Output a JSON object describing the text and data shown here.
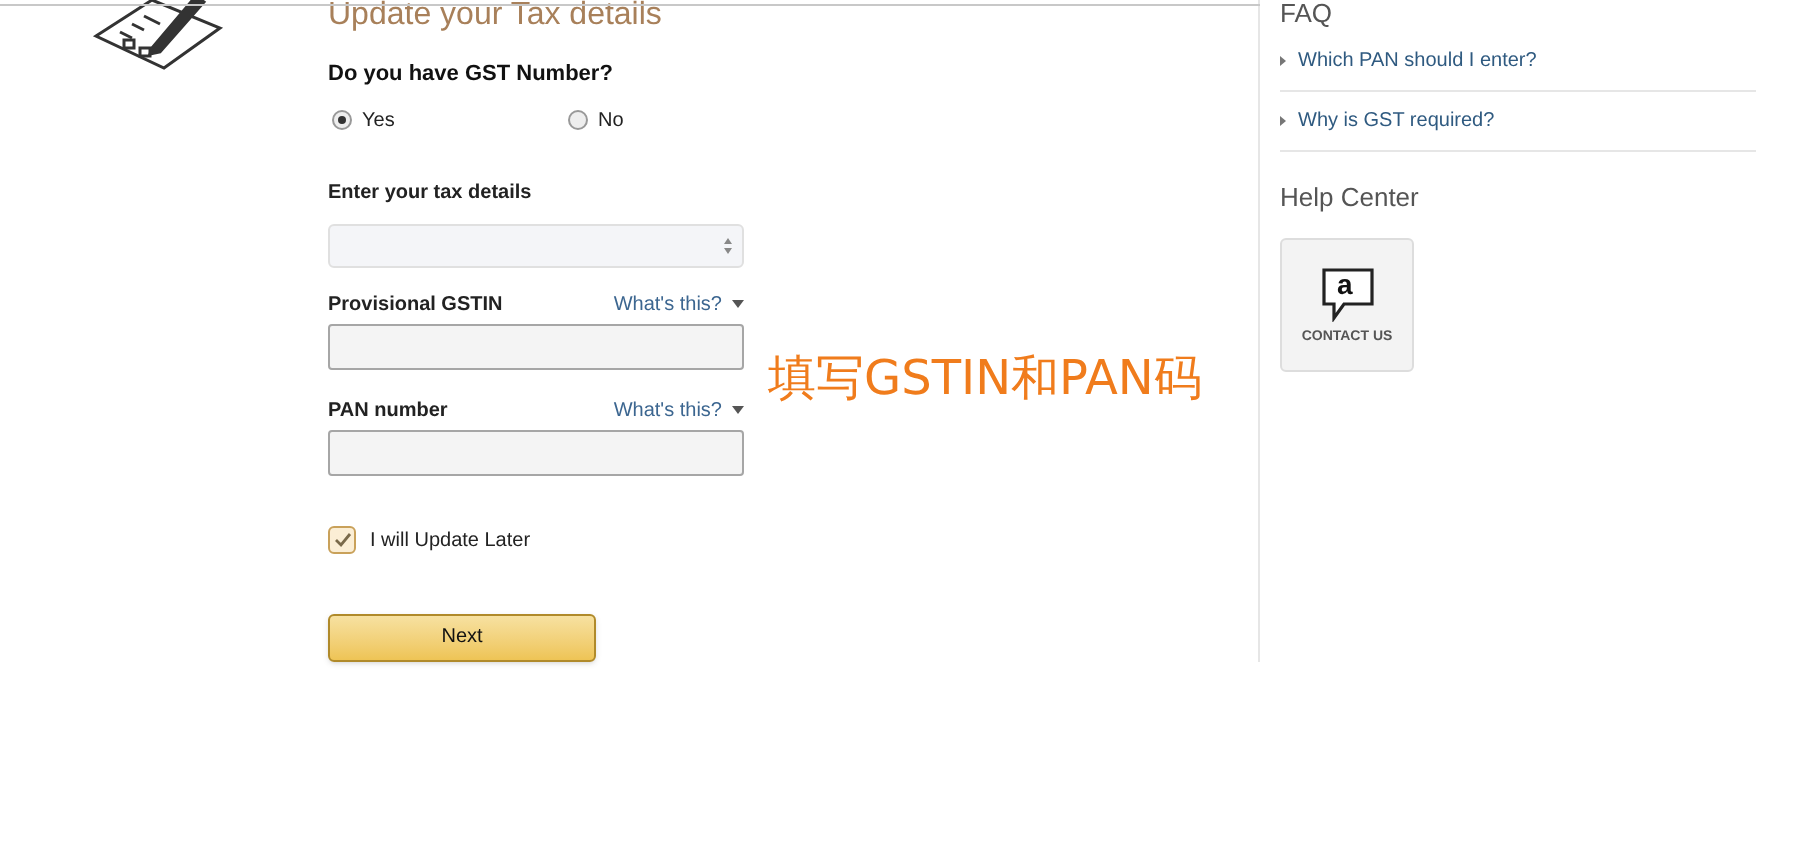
{
  "title": "Update your Tax details",
  "gst_question": {
    "label": "Do you have GST Number?",
    "options": [
      {
        "label": "Yes",
        "selected": true
      },
      {
        "label": "No",
        "selected": false
      }
    ]
  },
  "tax_details": {
    "label": "Enter your tax details"
  },
  "fields": [
    {
      "label": "Provisional GSTIN",
      "help": "What's this?"
    },
    {
      "label": "PAN number",
      "help": "What's this?"
    }
  ],
  "update_later": {
    "label": "I will Update Later",
    "checked": true
  },
  "next_button": "Next",
  "caption": "填写GSTIN和PAN码",
  "sidebar": {
    "faq_title": "FAQ",
    "faq_items": [
      "Which PAN should I enter?",
      "Why is GST required?"
    ],
    "help_title": "Help Center",
    "contact": {
      "logo": "a",
      "label": "CONTACT US"
    }
  }
}
